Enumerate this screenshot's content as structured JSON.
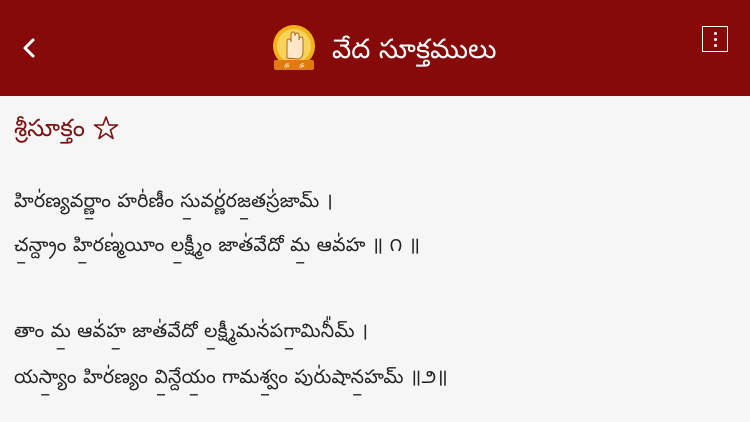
{
  "header": {
    "title": "వేద సూక్తములు",
    "back_icon": "chevron-left-icon",
    "menu_icon": "vertical-dots-icon",
    "logo_icon": "blessing-hand-logo"
  },
  "section": {
    "title": "శ్రీసూక్తం",
    "favorite_icon": "star-outline-icon"
  },
  "verses": [
    "హిర॑ణ్యవర్ణాం॒ హరి॑ణీం సు॒వర్ణ॑రజ॒తస్ర॑జామ్ ।",
    "చ॒న్ద్రాం హి॒రణ్మ॑యీం ల॒క్ష్మీం జాత॑వేదో మ॒ ఆవ॑హ ॥ ౧ ॥",
    "తాం మ॒ ఆవ॑హ॒ జాత॑వేదో ల॒క్ష్మీమన॑పగా॒మినీ᳚మ్ ।",
    "యస్యాం॒ హిర॑ణ్యం వి॒న్దేయం॒ గామశ్వం॒ పురు॑షాన॒హమ్ ॥౨॥"
  ],
  "colors": {
    "appbar": "#860a0a",
    "section_title": "#7a1212",
    "background": "#f6f6f6"
  }
}
